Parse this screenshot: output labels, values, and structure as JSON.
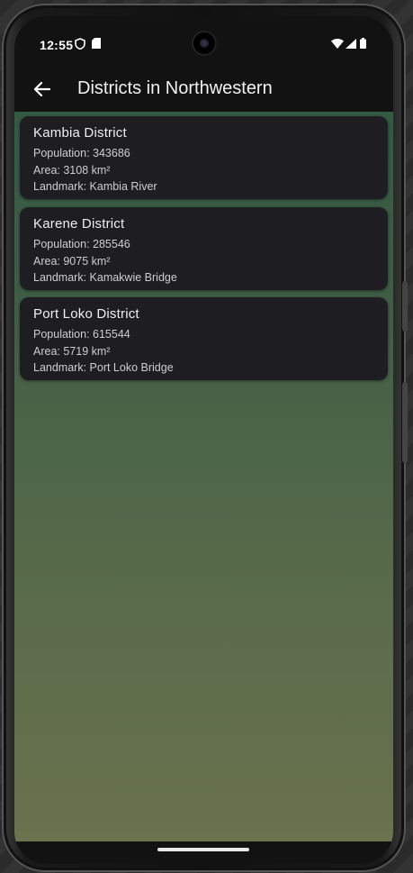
{
  "status_bar": {
    "time": "12:55"
  },
  "app_bar": {
    "title": "Districts in Northwestern"
  },
  "districts": [
    {
      "name": "Kambia District",
      "population": "Population: 343686",
      "area": "Area: 3108 km²",
      "landmark": "Landmark: Kambia River"
    },
    {
      "name": "Karene District",
      "population": "Population: 285546",
      "area": "Area: 9075 km²",
      "landmark": "Landmark: Kamakwie Bridge"
    },
    {
      "name": "Port Loko District",
      "population": "Population: 615544",
      "area": "Area: 5719 km²",
      "landmark": "Landmark: Port Loko Bridge"
    }
  ],
  "colors": {
    "app_bar": "#121212",
    "card": "#1d1d22",
    "background_top": "#345a44",
    "background_bottom": "#6a724e"
  }
}
